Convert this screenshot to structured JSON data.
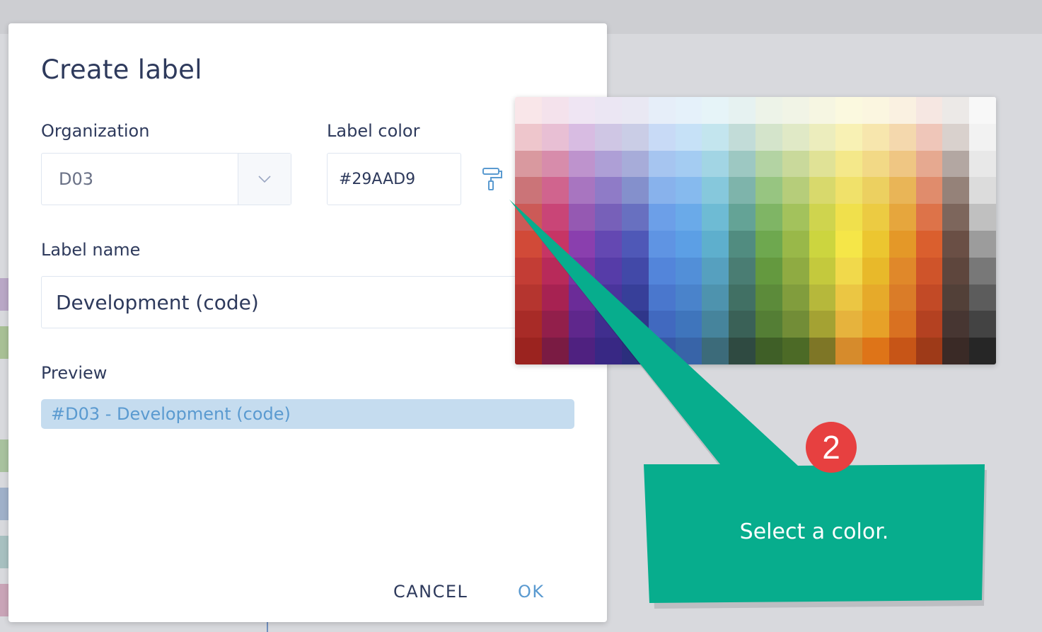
{
  "dialog": {
    "title": "Create label",
    "organization_label": "Organization",
    "organization_value": "D03",
    "label_color_label": "Label color",
    "label_color_value": "#29AAD9",
    "label_name_label": "Label name",
    "label_name_value": "Development (code)",
    "preview_label": "Preview",
    "preview_text": "#D03 - Development (code)",
    "cancel_label": "CANCEL",
    "ok_label": "OK"
  },
  "callout": {
    "step": "2",
    "text": "Select a color."
  },
  "colors": {
    "callout_bg": "#07ad8d",
    "badge_bg": "#e74040",
    "accent": "#5a9ad0",
    "preview_chip_bg": "#c5dcef"
  },
  "icons": {
    "paint_roller": "paint-roller-icon",
    "dropdown": "chevron-down-icon"
  },
  "palette": {
    "rows": [
      [
        "#f9e6e9",
        "#f4e2ec",
        "#efe5f3",
        "#ebe6f3",
        "#e9e8f3",
        "#e6eef9",
        "#e5f1fa",
        "#e6f4f8",
        "#e6f2f1",
        "#edf3e8",
        "#f1f4e6",
        "#f6f6e2",
        "#fbf9df",
        "#fbf6e0",
        "#faf1e1",
        "#f6e7e2",
        "#ece9e7",
        "#f8f8f8"
      ],
      [
        "#eec6cc",
        "#e8bfd4",
        "#d8bce2",
        "#cfc6e4",
        "#cacde6",
        "#c8daf6",
        "#c6e1f7",
        "#c3e5ee",
        "#c2dcd8",
        "#d4e4cb",
        "#e0e9c6",
        "#ecedbd",
        "#f8f1b4",
        "#f7e6ad",
        "#f4d8ad",
        "#efc6b9",
        "#d9d1cd",
        "#f2f2f2"
      ],
      [
        "#d9999f",
        "#d78cab",
        "#be93cd",
        "#ae9fd6",
        "#a7acd9",
        "#a6c5f0",
        "#a4ccf2",
        "#a2d5e4",
        "#9dc8c2",
        "#b3d3a3",
        "#c9d99b",
        "#e0e296",
        "#f4e88a",
        "#f2d986",
        "#efc683",
        "#e6a990",
        "#b3a7a2",
        "#e8e8e8"
      ],
      [
        "#cb7478",
        "#d0648e",
        "#a875c0",
        "#8f7bc7",
        "#8490cc",
        "#88b2ec",
        "#86baee",
        "#86c8dc",
        "#7eb4ab",
        "#97c581",
        "#b6cd7a",
        "#d8d96c",
        "#f0e16a",
        "#ecd060",
        "#e9b557",
        "#e08c6c",
        "#958279",
        "#dcdcdc"
      ],
      [
        "#cc5a57",
        "#c94577",
        "#9559b2",
        "#7760b9",
        "#6870c0",
        "#6c9fe8",
        "#6aaae9",
        "#6ebbd4",
        "#64a396",
        "#7fb565",
        "#a3c25c",
        "#cfd44e",
        "#f0e04c",
        "#eccb42",
        "#e6a63d",
        "#dd7349",
        "#7d665c",
        "#c0c0c0"
      ],
      [
        "#d14a38",
        "#c63565",
        "#8a3fae",
        "#6448b2",
        "#4f58b7",
        "#5f94e3",
        "#5c9fe5",
        "#5eafcd",
        "#518c80",
        "#6ea84f",
        "#99b849",
        "#ccd53f",
        "#f5e648",
        "#ecc630",
        "#e49828",
        "#da5f2e",
        "#6a4f45",
        "#9c9c9c"
      ],
      [
        "#c33d35",
        "#b82a5a",
        "#7b33a3",
        "#563ca8",
        "#4249a8",
        "#5385da",
        "#528fd8",
        "#56a0bf",
        "#4a7d73",
        "#64993f",
        "#8fab42",
        "#c4c93d",
        "#f1d94b",
        "#e8b92a",
        "#e0882a",
        "#cf542a",
        "#5e463d",
        "#787878"
      ],
      [
        "#b5352f",
        "#a72252",
        "#6b2c98",
        "#4a349c",
        "#373f99",
        "#4a77cd",
        "#4a83cb",
        "#4e93ae",
        "#417064",
        "#5c8b3a",
        "#819d3d",
        "#b6b83b",
        "#ebc643",
        "#e6aa2a",
        "#da7c28",
        "#c24a26",
        "#524038",
        "#5c5c5c"
      ],
      [
        "#a82b27",
        "#921f4b",
        "#5f278c",
        "#402e8e",
        "#2f368a",
        "#4169bf",
        "#3f75bc",
        "#46849c",
        "#3a6157",
        "#547e35",
        "#728d37",
        "#a4a233",
        "#e6b33d",
        "#e7a128",
        "#d97121",
        "#b44121",
        "#473632",
        "#434343"
      ],
      [
        "#9b231f",
        "#7a1b43",
        "#4f2180",
        "#382884",
        "#2b2e7d",
        "#3758a8",
        "#3864a8",
        "#3c6b7a",
        "#2f4a41",
        "#3f5f27",
        "#4c6a26",
        "#7e7626",
        "#d68b2c",
        "#de7418",
        "#c75517",
        "#9e3a18",
        "#3a2a26",
        "#262626"
      ]
    ]
  }
}
